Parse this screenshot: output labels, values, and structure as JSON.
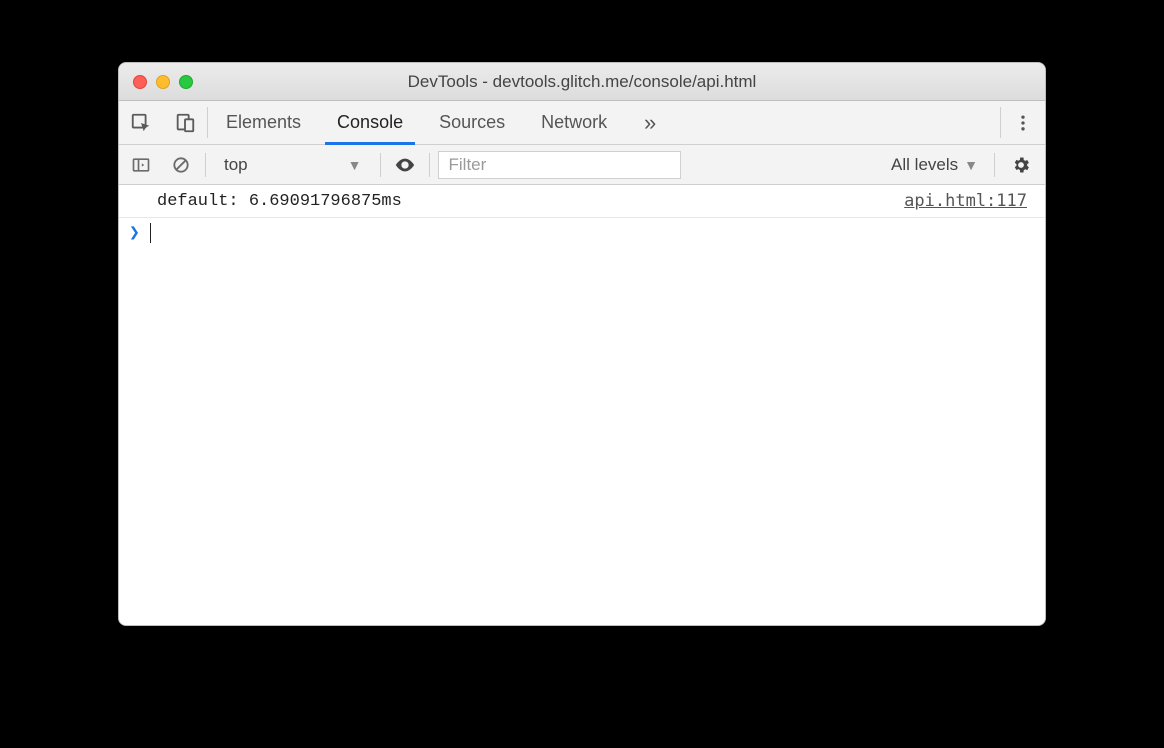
{
  "window": {
    "title": "DevTools - devtools.glitch.me/console/api.html"
  },
  "tabs": {
    "items": [
      "Elements",
      "Console",
      "Sources",
      "Network"
    ],
    "active_index": 1,
    "overflow_glyph": "»"
  },
  "filterbar": {
    "context": "top",
    "filter_placeholder": "Filter",
    "levels_label": "All levels"
  },
  "log": {
    "rows": [
      {
        "message": "default: 6.69091796875ms",
        "source": "api.html:117"
      }
    ],
    "prompt_glyph": "❯"
  }
}
